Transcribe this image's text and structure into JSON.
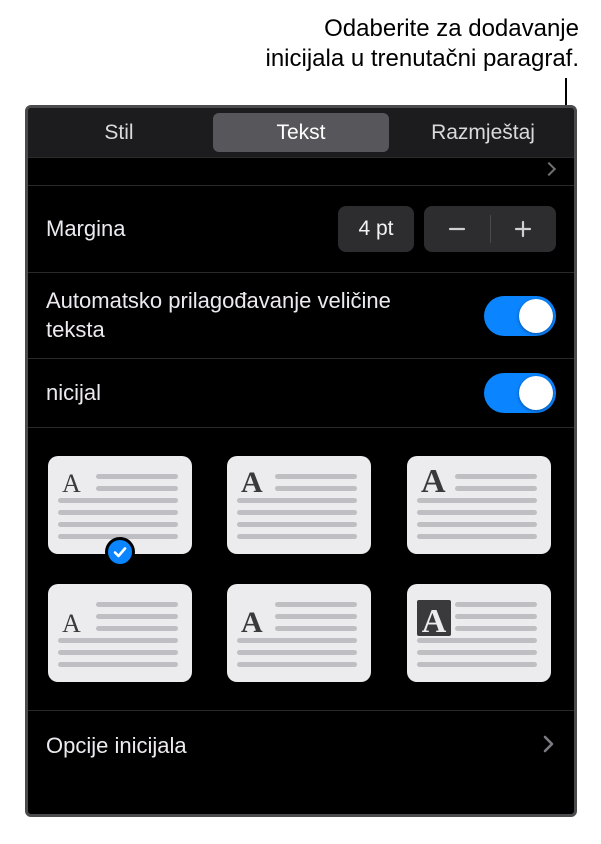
{
  "callout": {
    "line1": "Odaberite za dodavanje",
    "line2": "inicijala u trenutačni paragraf."
  },
  "tabs": {
    "style": "Stil",
    "text": "Tekst",
    "layout": "Razmještaj",
    "active": "text"
  },
  "margin": {
    "label": "Margina",
    "value": "4 pt"
  },
  "autosize": {
    "label": "Automatsko prilagođavanje veličine teksta",
    "on": true
  },
  "dropcap": {
    "label": "nicijal",
    "on": true,
    "options_link": "Opcije inicijala",
    "options": [
      {
        "id": "raised-small",
        "style": "raised",
        "weight": "light",
        "boxed": false,
        "selected": true
      },
      {
        "id": "raised-medium",
        "style": "raised",
        "weight": "medium",
        "boxed": false,
        "selected": false
      },
      {
        "id": "raised-bold",
        "style": "raised",
        "weight": "bold",
        "boxed": false,
        "selected": false
      },
      {
        "id": "dropped-light",
        "style": "dropped",
        "weight": "light",
        "boxed": false,
        "selected": false
      },
      {
        "id": "dropped-medium",
        "style": "dropped",
        "weight": "medium",
        "boxed": false,
        "selected": false
      },
      {
        "id": "dropped-boxed",
        "style": "dropped",
        "weight": "bold",
        "boxed": true,
        "selected": false
      }
    ]
  },
  "colors": {
    "accent": "#0a84ff",
    "panel": "#000000",
    "card": "#ececef",
    "line": "#bfbfc3"
  }
}
